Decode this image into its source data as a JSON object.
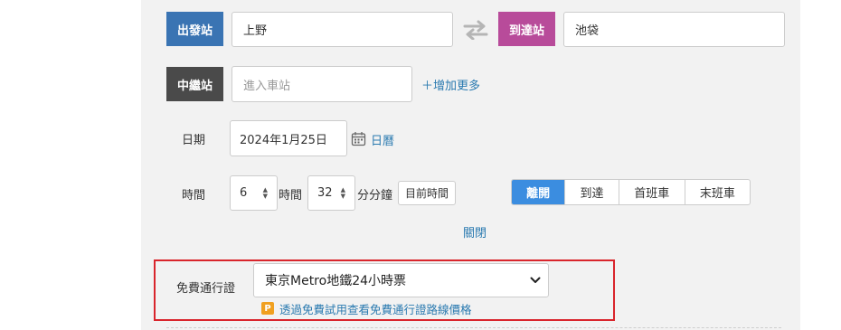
{
  "from": {
    "label": "出發站",
    "value": "上野",
    "color": "#3a74b3"
  },
  "to": {
    "label": "到達站",
    "value": "池袋",
    "color": "#b84b9a"
  },
  "swap": {
    "icon": "swap-arrows-icon"
  },
  "via": {
    "label": "中繼站",
    "placeholder": "進入車站",
    "color": "#4a4a4a"
  },
  "add_more": "＋增加更多",
  "date": {
    "label": "日期",
    "value": "2024年1月25日",
    "calendar_link": "日曆"
  },
  "time": {
    "label": "時間",
    "hour": "6",
    "hour_unit": "時間",
    "minute": "32",
    "minute_unit": "分分鐘",
    "now_button": "目前時間",
    "modes": [
      "離開",
      "到達",
      "首班車",
      "末班車"
    ],
    "active_mode": "離開"
  },
  "close_link": "關閉",
  "free_pass": {
    "label": "免費通行證",
    "selected": "東京Metro地鐵24小時票",
    "badge": "P",
    "promo_link": "透過免費試用查看免費通行證路線價格"
  },
  "colors": {
    "accent": "#3b8de0",
    "highlight_border": "#d9252c",
    "link": "#2a7ab0",
    "badge": "#f0a020"
  }
}
